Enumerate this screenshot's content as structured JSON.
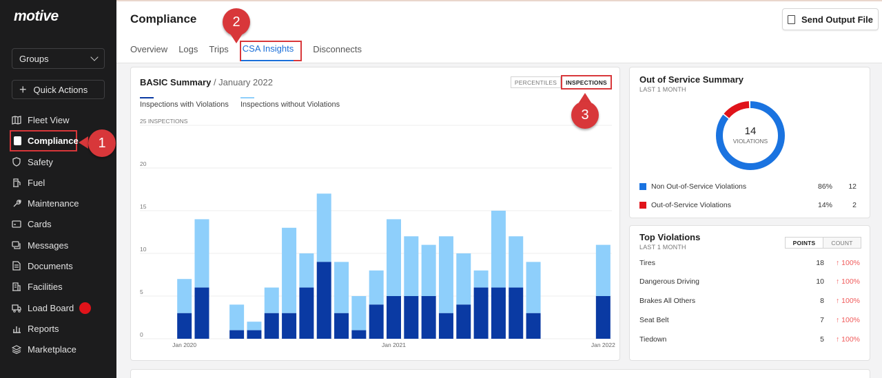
{
  "sidebar": {
    "logo": "motive",
    "groups_label": "Groups",
    "quick_actions_label": "Quick Actions",
    "items": [
      {
        "label": "Fleet View",
        "icon": "map-icon"
      },
      {
        "label": "Compliance",
        "icon": "document-icon",
        "active": true
      },
      {
        "label": "Safety",
        "icon": "shield-icon"
      },
      {
        "label": "Fuel",
        "icon": "fuel-pump-icon"
      },
      {
        "label": "Maintenance",
        "icon": "wrench-icon"
      },
      {
        "label": "Cards",
        "icon": "card-icon"
      },
      {
        "label": "Messages",
        "icon": "chat-icon"
      },
      {
        "label": "Documents",
        "icon": "file-icon"
      },
      {
        "label": "Facilities",
        "icon": "building-icon"
      },
      {
        "label": "Load Board",
        "icon": "truck-icon",
        "badge_color": "#e0131a"
      },
      {
        "label": "Reports",
        "icon": "bar-chart-icon"
      },
      {
        "label": "Marketplace",
        "icon": "layers-icon"
      }
    ]
  },
  "callouts": [
    "1",
    "2",
    "3"
  ],
  "header": {
    "title": "Compliance",
    "send_button": "Send Output File",
    "tabs": [
      "Overview",
      "Logs",
      "Trips",
      "CSA Insights",
      "Disconnects"
    ],
    "active_tab": "CSA Insights"
  },
  "basic_summary": {
    "title": "BASIC Summary",
    "period": "/ January 2022",
    "toggle": [
      "PERCENTILES",
      "INSPECTIONS"
    ],
    "toggle_selected": "INSPECTIONS",
    "legend": [
      {
        "label": "Inspections with Violations",
        "color": "#0a3aa3"
      },
      {
        "label": "Inspections without Violations",
        "color": "#8ecffb"
      }
    ]
  },
  "chart_data": {
    "type": "bar",
    "stacked": true,
    "y_axis_title": "25 INSPECTIONS",
    "ylim": [
      0,
      25
    ],
    "y_ticks": [
      "25 INSPECTIONS",
      "20",
      "15",
      "10",
      "5",
      "0"
    ],
    "x_tick_labels": [
      "Jan 2020",
      "Jan 2021",
      "Jan 2022"
    ],
    "grid": true,
    "categories": [
      "Jan 2020",
      "Feb 2020",
      "Mar 2020",
      "Apr 2020",
      "May 2020",
      "Jun 2020",
      "Jul 2020",
      "Aug 2020",
      "Sep 2020",
      "Oct 2020",
      "Nov 2020",
      "Dec 2020",
      "Jan 2021",
      "Feb 2021",
      "Mar 2021",
      "Apr 2021",
      "May 2021",
      "Jun 2021",
      "Jul 2021",
      "Aug 2021",
      "Sep 2021",
      "Oct 2021",
      "Nov 2021",
      "Dec 2021",
      "Jan 2022"
    ],
    "series": [
      {
        "name": "Inspections with Violations",
        "color": "#0a3aa3",
        "values": [
          3,
          6,
          0,
          1,
          1,
          3,
          3,
          6,
          9,
          3,
          1,
          4,
          5,
          5,
          5,
          3,
          4,
          6,
          6,
          6,
          3,
          0,
          0,
          0,
          5
        ]
      },
      {
        "name": "Inspections without Violations",
        "color": "#8ecffb",
        "values": [
          4,
          8,
          0,
          3,
          1,
          3,
          10,
          4,
          8,
          6,
          4,
          4,
          9,
          7,
          6,
          9,
          6,
          2,
          9,
          6,
          6,
          0,
          0,
          0,
          6
        ]
      }
    ]
  },
  "out_of_service": {
    "title": "Out of Service Summary",
    "subtitle": "LAST 1 MONTH",
    "total": "14",
    "total_label": "VIOLATIONS",
    "rows": [
      {
        "label": "Non Out-of-Service Violations",
        "percent": "86%",
        "count": "12",
        "color": "#1a73e0",
        "fraction": 0.86
      },
      {
        "label": "Out-of-Service Violations",
        "percent": "14%",
        "count": "2",
        "color": "#e0131a",
        "fraction": 0.14
      }
    ]
  },
  "top_violations": {
    "title": "Top Violations",
    "subtitle": "LAST 1 MONTH",
    "toggle": [
      "POINTS",
      "COUNT"
    ],
    "toggle_selected": "POINTS",
    "rows": [
      {
        "label": "Tires",
        "count": "18",
        "trend": "↑ 100%"
      },
      {
        "label": "Dangerous Driving",
        "count": "10",
        "trend": "↑ 100%"
      },
      {
        "label": "Brakes All Others",
        "count": "8",
        "trend": "↑ 100%"
      },
      {
        "label": "Seat Belt",
        "count": "7",
        "trend": "↑ 100%"
      },
      {
        "label": "Tiedown",
        "count": "5",
        "trend": "↑ 100%"
      }
    ]
  }
}
